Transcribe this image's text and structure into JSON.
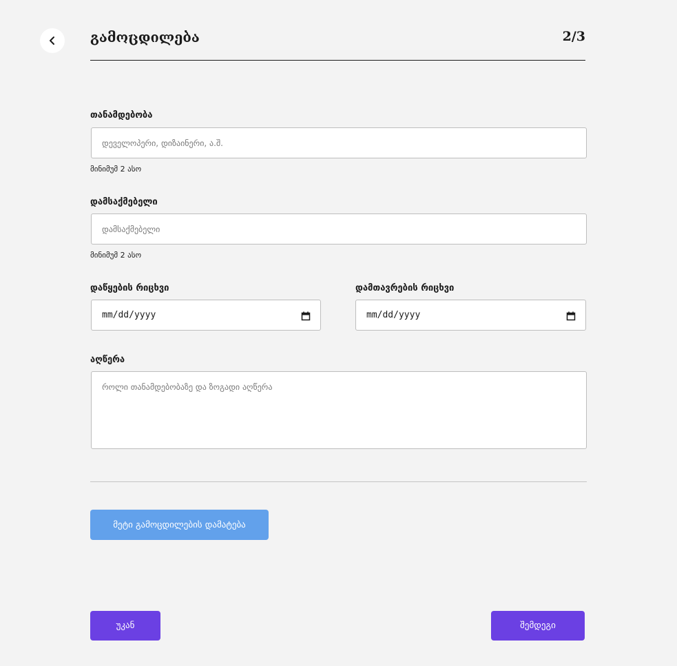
{
  "header": {
    "title": "გამოცდილება",
    "step": "2/3"
  },
  "form": {
    "position": {
      "label": "თანამდებობა",
      "placeholder": "დეველოპერი, დიზაინერი, ა.შ.",
      "hint": "მინიმუმ 2 ასო"
    },
    "employer": {
      "label": "დამსაქმებელი",
      "placeholder": "დამსაქმებელი",
      "hint": "მინიმუმ 2 ასო"
    },
    "start_date": {
      "label": "დაწყების რიცხვი",
      "value": "mm/dd/yyyy"
    },
    "end_date": {
      "label": "დამთავრების რიცხვი",
      "value": "mm/dd/yyyy"
    },
    "description": {
      "label": "აღწერა",
      "placeholder": "როლი თანამდებობაზე და ზოგადი აღწერა"
    }
  },
  "buttons": {
    "add_more": "მეტი გამოცდილების დამატება",
    "back": "უკან",
    "next": "შემდეგი"
  },
  "icons": {
    "back": "chevron-left-icon",
    "calendar": "calendar-icon"
  },
  "colors": {
    "primary": "#6b40e3",
    "add_button": "#62a1eb",
    "background": "#f3f3f3"
  }
}
